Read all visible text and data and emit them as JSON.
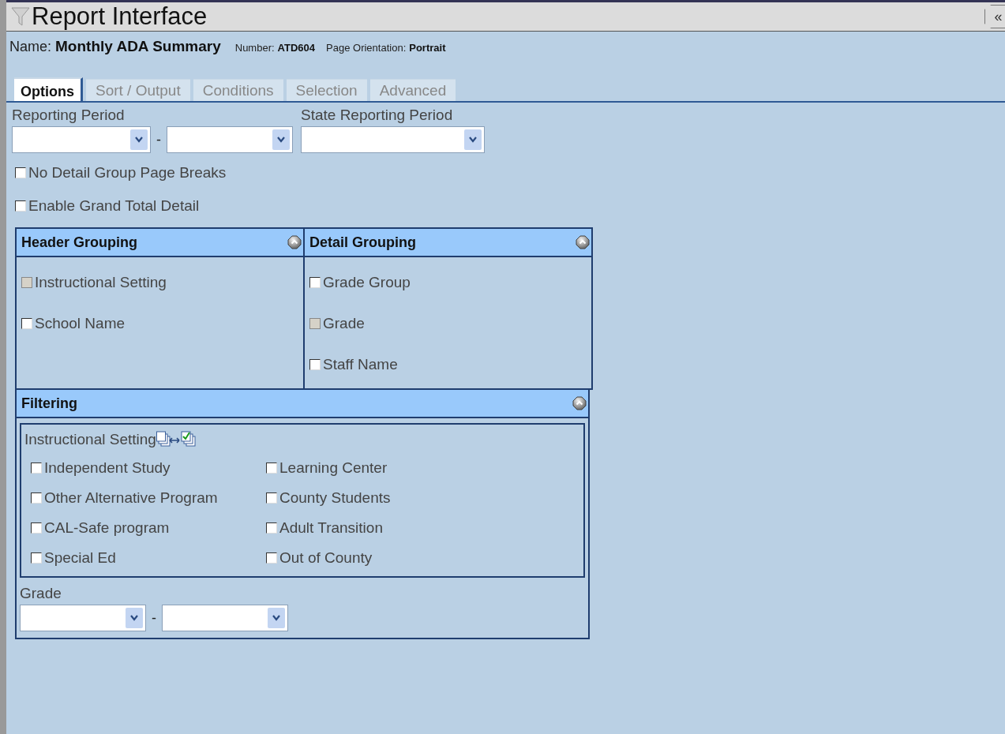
{
  "window": {
    "title": "Report Interface",
    "collapse_symbol": "«"
  },
  "report": {
    "name_label": "Name:",
    "name": "Monthly ADA Summary",
    "number_label": "Number:",
    "number": "ATD604",
    "orientation_label": "Page Orientation:",
    "orientation": "Portrait"
  },
  "tabs": [
    {
      "label": "Options",
      "selected": true
    },
    {
      "label": "Sort / Output",
      "selected": false
    },
    {
      "label": "Conditions",
      "selected": false
    },
    {
      "label": "Selection",
      "selected": false
    },
    {
      "label": "Advanced",
      "selected": false
    }
  ],
  "reporting_period": {
    "label": "Reporting Period",
    "separator": "-"
  },
  "state_reporting_period": {
    "label": "State Reporting Period"
  },
  "options": [
    {
      "label": "No Detail Group Page Breaks",
      "checked": false,
      "disabled": false
    },
    {
      "label": "Enable Grand Total Detail",
      "checked": false,
      "disabled": false
    }
  ],
  "header_grouping": {
    "title": "Header Grouping",
    "items": [
      {
        "label": "Instructional Setting",
        "checked": false,
        "disabled": true
      },
      {
        "label": "School Name",
        "checked": false,
        "disabled": false
      }
    ]
  },
  "detail_grouping": {
    "title": "Detail Grouping",
    "items": [
      {
        "label": "Grade Group",
        "checked": false,
        "disabled": false
      },
      {
        "label": "Grade",
        "checked": false,
        "disabled": true
      },
      {
        "label": "Staff Name",
        "checked": false,
        "disabled": false
      }
    ]
  },
  "filtering": {
    "title": "Filtering",
    "instructional_setting": {
      "label": "Instructional Setting",
      "items": [
        {
          "label": "Independent Study",
          "checked": false
        },
        {
          "label": "Learning Center",
          "checked": false
        },
        {
          "label": "Other Alternative Program",
          "checked": false
        },
        {
          "label": "County Students",
          "checked": false
        },
        {
          "label": "CAL-Safe program",
          "checked": false
        },
        {
          "label": "Adult Transition",
          "checked": false
        },
        {
          "label": "Special Ed",
          "checked": false
        },
        {
          "label": "Out of County",
          "checked": false
        }
      ]
    },
    "grade": {
      "label": "Grade",
      "separator": "-"
    }
  }
}
